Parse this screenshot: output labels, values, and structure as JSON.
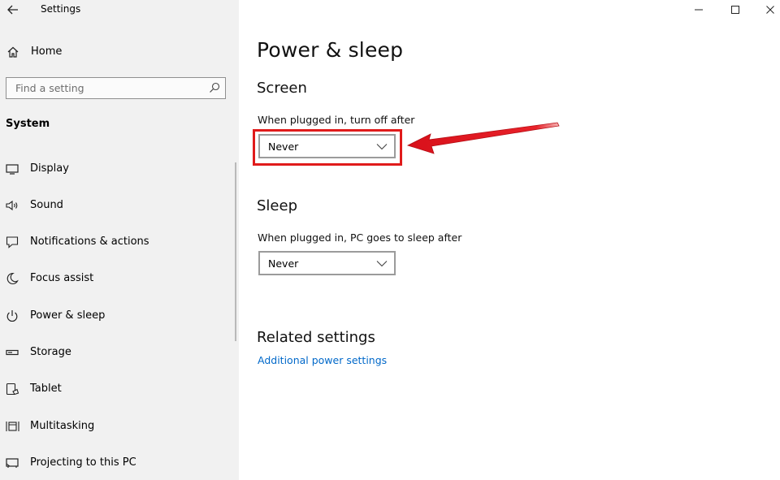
{
  "window": {
    "title": "Settings",
    "caption_buttons": [
      "minimize",
      "maximize",
      "close"
    ]
  },
  "sidebar": {
    "home_label": "Home",
    "search": {
      "placeholder": "Find a setting",
      "value": ""
    },
    "section_label": "System",
    "items": [
      {
        "label": "Display",
        "icon": "display-icon"
      },
      {
        "label": "Sound",
        "icon": "sound-icon"
      },
      {
        "label": "Notifications & actions",
        "icon": "notifications-icon"
      },
      {
        "label": "Focus assist",
        "icon": "focus-assist-icon"
      },
      {
        "label": "Power & sleep",
        "icon": "power-icon"
      },
      {
        "label": "Storage",
        "icon": "storage-icon"
      },
      {
        "label": "Tablet",
        "icon": "tablet-icon"
      },
      {
        "label": "Multitasking",
        "icon": "multitasking-icon"
      },
      {
        "label": "Projecting to this PC",
        "icon": "projecting-icon"
      }
    ]
  },
  "main": {
    "title": "Power & sleep",
    "screen": {
      "heading": "Screen",
      "label": "When plugged in, turn off after",
      "value": "Never"
    },
    "sleep": {
      "heading": "Sleep",
      "label": "When plugged in, PC goes to sleep after",
      "value": "Never"
    },
    "related": {
      "heading": "Related settings",
      "link": "Additional power settings"
    }
  },
  "colors": {
    "highlight": "#e01b1b",
    "link": "#0068c9",
    "sidebar_bg": "#f1f1f1"
  }
}
